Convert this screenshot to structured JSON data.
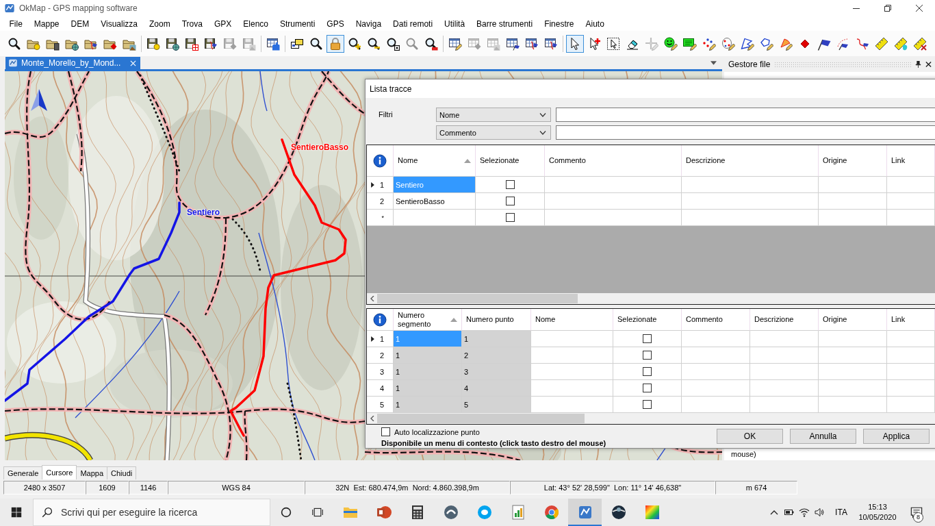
{
  "window": {
    "title": "OkMap - GPS mapping software"
  },
  "menu": [
    "File",
    "Mappe",
    "DEM",
    "Visualizza",
    "Zoom",
    "Trova",
    "GPX",
    "Elenco",
    "Strumenti",
    "GPS",
    "Naviga",
    "Dati remoti",
    "Utilità",
    "Barre strumenti",
    "Finestre",
    "Aiuto"
  ],
  "toolbar": [
    {
      "selected": false,
      "disabled": false
    },
    {
      "selected": false,
      "disabled": false
    },
    {
      "selected": false,
      "disabled": false
    },
    {
      "selected": false,
      "disabled": false
    },
    {
      "selected": false,
      "disabled": false
    },
    {
      "selected": false,
      "disabled": false
    },
    {
      "selected": false,
      "disabled": false
    },
    {
      "selected": false,
      "disabled": false
    },
    {
      "selected": false,
      "disabled": false
    },
    {
      "selected": false,
      "disabled": false
    },
    {
      "selected": false,
      "disabled": false
    },
    {
      "selected": false,
      "disabled": true
    },
    {
      "selected": false,
      "disabled": true
    },
    {
      "selected": false,
      "disabled": false
    },
    {
      "selected": false,
      "disabled": false
    },
    {
      "selected": false,
      "disabled": false
    },
    {
      "selected": true,
      "disabled": false
    },
    {
      "selected": false,
      "disabled": false
    },
    {
      "selected": false,
      "disabled": false
    },
    {
      "selected": false,
      "disabled": false
    },
    {
      "selected": false,
      "disabled": true
    },
    {
      "selected": false,
      "disabled": false
    },
    {
      "selected": false,
      "disabled": false
    },
    {
      "selected": false,
      "disabled": true
    },
    {
      "selected": false,
      "disabled": true
    },
    {
      "selected": false,
      "disabled": false
    },
    {
      "selected": false,
      "disabled": false
    },
    {
      "selected": false,
      "disabled": false
    },
    {
      "selected": true,
      "disabled": false
    },
    {
      "selected": false,
      "disabled": false
    },
    {
      "selected": false,
      "disabled": false
    },
    {
      "selected": false,
      "disabled": false
    },
    {
      "selected": false,
      "disabled": true
    },
    {
      "selected": false,
      "disabled": false
    },
    {
      "selected": false,
      "disabled": false
    },
    {
      "selected": false,
      "disabled": false
    },
    {
      "selected": false,
      "disabled": false
    },
    {
      "selected": false,
      "disabled": false
    },
    {
      "selected": false,
      "disabled": false
    },
    {
      "selected": false,
      "disabled": false
    },
    {
      "selected": false,
      "disabled": false
    },
    {
      "selected": false,
      "disabled": false
    },
    {
      "selected": false,
      "disabled": false
    },
    {
      "selected": false,
      "disabled": false
    },
    {
      "selected": false,
      "disabled": false
    },
    {
      "selected": false,
      "disabled": false
    },
    {
      "selected": false,
      "disabled": false
    }
  ],
  "document_tabs": [
    {
      "label": "Monte_Morello_by_Mond...",
      "selected": true
    }
  ],
  "map": {
    "tracks": [
      {
        "name": "Sentiero",
        "color": "#1414e6"
      },
      {
        "name": "SentieroBasso",
        "color": "#ff0000"
      }
    ]
  },
  "side_panel": {
    "title": "Gestore file",
    "text": "mouse)"
  },
  "dialog": {
    "title": "Lista tracce",
    "filters_label": "Filtri",
    "filters": [
      {
        "field": "Nome"
      },
      {
        "field": "Commento"
      }
    ],
    "tracks_table": {
      "columns": [
        {
          "label": "Nome",
          "kind": "name",
          "sorted": true
        },
        {
          "label": "Selezionate",
          "kind": "check",
          "sorted": false
        },
        {
          "label": "Commento",
          "kind": "text",
          "sorted": false
        },
        {
          "label": "Descrizione",
          "kind": "text",
          "sorted": false
        },
        {
          "label": "Origine",
          "kind": "text",
          "sorted": false
        },
        {
          "label": "Link",
          "kind": "text",
          "sorted": false
        }
      ],
      "rows": [
        {
          "header": "1",
          "name": "Sentiero",
          "checked": false,
          "selected": true
        },
        {
          "header": "2",
          "name": "SentieroBasso",
          "checked": false,
          "selected": false
        },
        {
          "header": "*",
          "checked": false,
          "selected": false
        }
      ]
    },
    "points_table": {
      "columns": [
        {
          "label": "Numero segmento",
          "kind": "segment",
          "sorted": true
        },
        {
          "label": "Numero punto",
          "kind": "point",
          "sorted": false
        },
        {
          "label": "Nome",
          "kind": "text",
          "sorted": false
        },
        {
          "label": "Selezionate",
          "kind": "check",
          "sorted": false
        },
        {
          "label": "Commento",
          "kind": "text",
          "sorted": false
        },
        {
          "label": "Descrizione",
          "kind": "text",
          "sorted": false
        },
        {
          "label": "Origine",
          "kind": "text",
          "sorted": false
        },
        {
          "label": "Link",
          "kind": "text",
          "sorted": false
        }
      ],
      "rows": [
        {
          "header": "1",
          "segment": "1",
          "point": "1",
          "checked": false,
          "selected": true
        },
        {
          "header": "2",
          "segment": "1",
          "point": "2",
          "checked": false,
          "selected": false
        },
        {
          "header": "3",
          "segment": "1",
          "point": "3",
          "checked": false,
          "selected": false
        },
        {
          "header": "4",
          "segment": "1",
          "point": "4",
          "checked": false,
          "selected": false
        },
        {
          "header": "5",
          "segment": "1",
          "point": "5",
          "checked": false,
          "selected": false
        }
      ]
    },
    "auto_locate": {
      "label": "Auto localizzazione punto",
      "checked": false
    },
    "hint": "Disponibile un menu di contesto (click tasto destro del mouse)",
    "buttons": [
      "OK",
      "Annulla",
      "Applica"
    ]
  },
  "bottom_tabs": [
    {
      "label": "Generale",
      "selected": false
    },
    {
      "label": "Cursore",
      "selected": true
    },
    {
      "label": "Mappa",
      "selected": false
    },
    {
      "label": "Chiudi",
      "selected": false
    }
  ],
  "status_bar": [
    "2480 x 3507",
    "1609",
    "1146",
    "WGS 84",
    "32N  Est: 680.474,9m  Nord: 4.860.398,9m",
    "Lat: 43° 52' 28,599\"  Lon: 11° 14' 46,638\"",
    "m 674"
  ],
  "taskbar": {
    "search": {
      "placeholder": "Scrivi qui per eseguire la ricerca"
    },
    "apps": [
      {
        "selected": false
      },
      {
        "selected": false
      },
      {
        "selected": false
      },
      {
        "selected": false
      },
      {
        "selected": false
      },
      {
        "selected": false
      },
      {
        "selected": false
      },
      {
        "selected": true
      },
      {
        "selected": false
      },
      {
        "selected": false
      }
    ],
    "language": "ITA",
    "time": "15:13",
    "date": "10/05/2020",
    "notification_count": "8"
  }
}
